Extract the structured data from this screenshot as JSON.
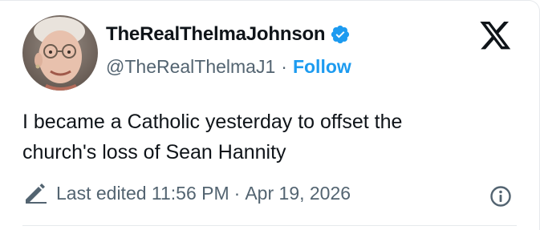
{
  "author": {
    "display_name": "TheRealThelmaJohnson",
    "handle": "@TheRealThelmaJ1",
    "separator": "·",
    "follow_label": "Follow",
    "avatar_icon": "avatar-photo",
    "verified_icon": "verified-badge-icon"
  },
  "tweet": {
    "text_line1": "I became a Catholic yesterday to offset the",
    "text_line2": "church's loss of Sean Hannity"
  },
  "meta": {
    "edit_icon": "pencil-icon",
    "edited_label": "Last edited 11:56 PM",
    "separator": "·",
    "date": "Apr 19, 2026",
    "info_icon": "info-icon"
  },
  "platform": {
    "logo_icon": "x-logo-icon"
  },
  "colors": {
    "accent": "#1d9bf0",
    "text_primary": "#0f1419",
    "text_secondary": "#536471",
    "border": "#e6e9ec"
  }
}
